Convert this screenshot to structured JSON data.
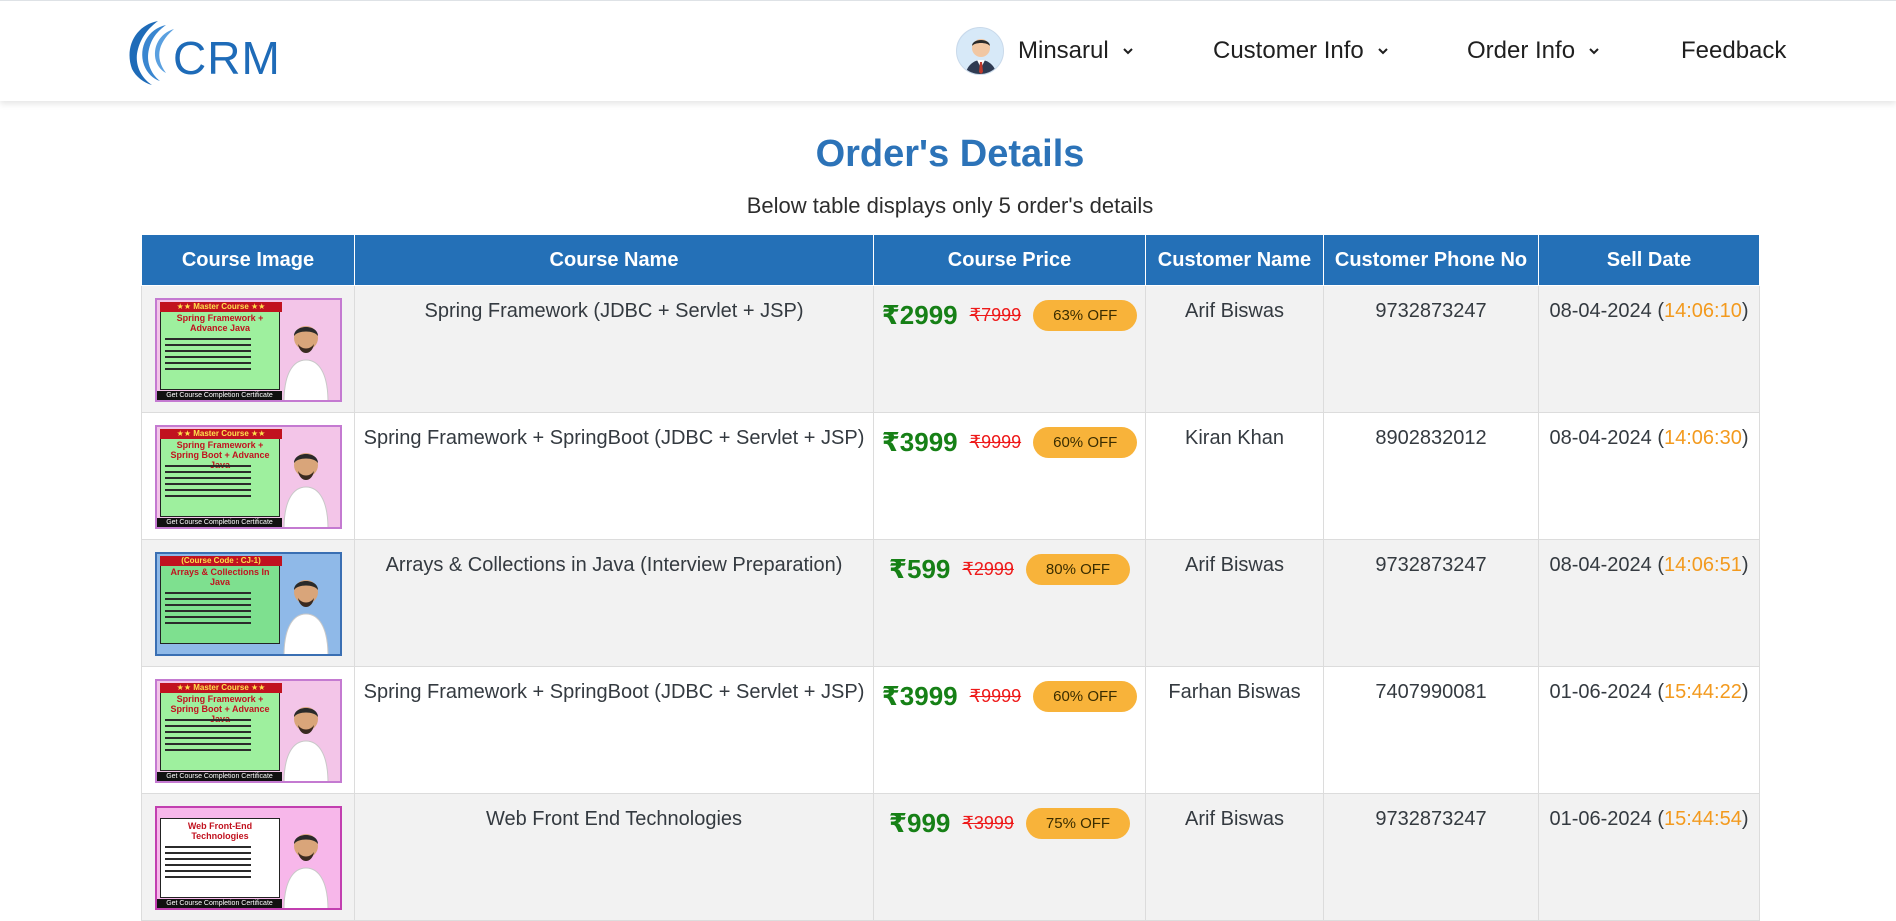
{
  "brand": {
    "name": "CRM"
  },
  "nav": {
    "user": "Minsarul",
    "customer_info": "Customer Info",
    "order_info": "Order Info",
    "feedback": "Feedback"
  },
  "page": {
    "title": "Order's Details",
    "subtitle": "Below table displays only 5 order's details"
  },
  "table": {
    "headers": [
      "Course Image",
      "Course Name",
      "Course Price",
      "Customer Name",
      "Customer Phone No",
      "Sell Date"
    ],
    "rows": [
      {
        "thumb": {
          "head": "★★ Master Course ★★",
          "title": "Spring Framework + Advance Java",
          "footer": "Get Course Completion Certificate",
          "variant": "pink-green"
        },
        "course_name": "Spring Framework (JDBC + Servlet + JSP)",
        "price": "₹2999",
        "old_price": "₹7999",
        "discount": "63% OFF",
        "customer": "Arif Biswas",
        "phone": "9732873247",
        "date": "08-04-2024",
        "time": "14:06:10"
      },
      {
        "thumb": {
          "head": "★★ Master Course ★★",
          "title": "Spring Framework + Spring Boot + Advance Java",
          "footer": "Get Course Completion Certificate",
          "variant": "pink-green"
        },
        "course_name": "Spring Framework + SpringBoot (JDBC + Servlet + JSP)",
        "price": "₹3999",
        "old_price": "₹9999",
        "discount": "60% OFF",
        "customer": "Kiran Khan",
        "phone": "8902832012",
        "date": "08-04-2024",
        "time": "14:06:30"
      },
      {
        "thumb": {
          "head": "(Course Code : CJ-1)",
          "title": "Arrays & Collections In Java",
          "footer": "",
          "variant": "blue"
        },
        "course_name": "Arrays & Collections in Java (Interview Preparation)",
        "price": "₹599",
        "old_price": "₹2999",
        "discount": "80% OFF",
        "customer": "Arif Biswas",
        "phone": "9732873247",
        "date": "08-04-2024",
        "time": "14:06:51"
      },
      {
        "thumb": {
          "head": "★★ Master Course ★★",
          "title": "Spring Framework + Spring Boot + Advance Java",
          "footer": "Get Course Completion Certificate",
          "variant": "pink-green"
        },
        "course_name": "Spring Framework + SpringBoot (JDBC + Servlet + JSP)",
        "price": "₹3999",
        "old_price": "₹9999",
        "discount": "60% OFF",
        "customer": "Farhan Biswas",
        "phone": "7407990081",
        "date": "01-06-2024",
        "time": "15:44:22"
      },
      {
        "thumb": {
          "head": "",
          "title": "Web Front-End Technologies",
          "footer": "Get Course Completion Certificate",
          "variant": "pink"
        },
        "course_name": "Web Front End Technologies",
        "price": "₹999",
        "old_price": "₹3999",
        "discount": "75% OFF",
        "customer": "Arif Biswas",
        "phone": "9732873247",
        "date": "01-06-2024",
        "time": "15:44:54"
      }
    ]
  },
  "colors": {
    "brand_blue": "#1e6bb8",
    "header_blue": "#2470b7",
    "price_green": "#168016",
    "old_price_red": "#ee1a1a",
    "badge_orange": "#f8b33a",
    "time_orange": "#f39a1e"
  },
  "icons": [
    "crm-logo-icon",
    "user-avatar-icon",
    "chevron-down-icon"
  ]
}
